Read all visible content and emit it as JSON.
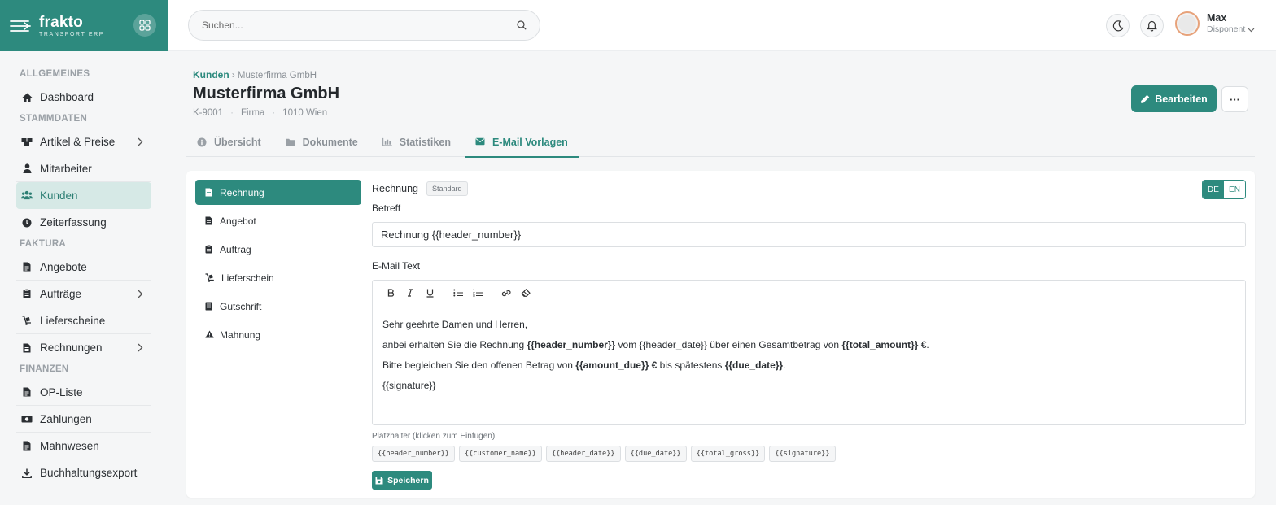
{
  "brand": {
    "name": "frakto",
    "subtitle": "TRANSPORT ERP"
  },
  "sidebar": {
    "sections": [
      {
        "title": "ALLGEMEINES",
        "items": [
          {
            "label": "Dashboard",
            "icon": "home-icon"
          }
        ]
      },
      {
        "title": "STAMMDATEN",
        "items": [
          {
            "label": "Artikel & Preise",
            "icon": "boxes-icon",
            "chevron": true
          },
          {
            "label": "Mitarbeiter",
            "icon": "user-icon"
          },
          {
            "label": "Kunden",
            "icon": "users-icon",
            "active": true
          },
          {
            "label": "Zeiterfassung",
            "icon": "clock-icon"
          }
        ]
      },
      {
        "title": "FAKTURA",
        "items": [
          {
            "label": "Angebote",
            "icon": "file-icon"
          },
          {
            "label": "Aufträge",
            "icon": "clipboard-icon",
            "chevron": true
          },
          {
            "label": "Lieferscheine",
            "icon": "dolly-icon"
          },
          {
            "label": "Rechnungen",
            "icon": "invoice-icon",
            "chevron": true
          }
        ]
      },
      {
        "title": "FINANZEN",
        "items": [
          {
            "label": "OP-Liste",
            "icon": "file-icon"
          },
          {
            "label": "Zahlungen",
            "icon": "money-icon"
          },
          {
            "label": "Mahnwesen",
            "icon": "file-icon"
          },
          {
            "label": "Buchhaltungsexport",
            "icon": "download-icon"
          }
        ]
      }
    ]
  },
  "topbar": {
    "search_placeholder": "Suchen...",
    "user": {
      "name": "Max",
      "role": "Disponent"
    }
  },
  "page": {
    "breadcrumb": {
      "parent": "Kunden",
      "current": "Musterfirma GmbH"
    },
    "title": "Musterfirma GmbH",
    "meta": [
      "K-9001",
      "Firma",
      "1010 Wien"
    ],
    "edit_label": "Bearbeiten",
    "more_label": "···"
  },
  "tabs": [
    {
      "label": "Übersicht",
      "icon": "info-icon"
    },
    {
      "label": "Dokumente",
      "icon": "folder-icon"
    },
    {
      "label": "Statistiken",
      "icon": "chart-icon"
    },
    {
      "label": "E-Mail Vorlagen",
      "icon": "envelope-icon",
      "active": true
    }
  ],
  "templates": [
    {
      "label": "Rechnung",
      "icon": "file-icon",
      "active": true
    },
    {
      "label": "Angebot",
      "icon": "file-icon"
    },
    {
      "label": "Auftrag",
      "icon": "clipboard-icon"
    },
    {
      "label": "Lieferschein",
      "icon": "dolly-icon"
    },
    {
      "label": "Gutschrift",
      "icon": "receipt-icon"
    },
    {
      "label": "Mahnung",
      "icon": "warning-icon"
    }
  ],
  "editor": {
    "template_name": "Rechnung",
    "badge": "Standard",
    "languages": [
      "DE",
      "EN"
    ],
    "active_language": "DE",
    "subject_label": "Betreff",
    "subject_value": "Rechnung {{header_number}}",
    "body_label": "E-Mail Text",
    "body": {
      "line1": "Sehr geehrte Damen und Herren,",
      "line2_a": "anbei erhalten Sie die Rechnung ",
      "line2_b": "{{header_number}}",
      "line2_c": " vom {{header_date}} über einen Gesamtbetrag von ",
      "line2_d": "{{total_amount}}",
      "line2_e": " €.",
      "line3_a": "Bitte begleichen Sie den offenen Betrag von ",
      "line3_b": "{{amount_due}} €",
      "line3_c": " bis spätestens ",
      "line3_d": "{{due_date}}",
      "line3_e": ".",
      "line4": "{{signature}}"
    },
    "placeholder_hint": "Platzhalter (klicken zum Einfügen):",
    "placeholders": [
      "{{header_number}}",
      "{{customer_name}}",
      "{{header_date}}",
      "{{due_date}}",
      "{{total_gross}}",
      "{{signature}}"
    ],
    "save_label": "Speichern"
  },
  "colors": {
    "primary": "#2d8a7e",
    "active_bg": "#d6e9e6"
  }
}
